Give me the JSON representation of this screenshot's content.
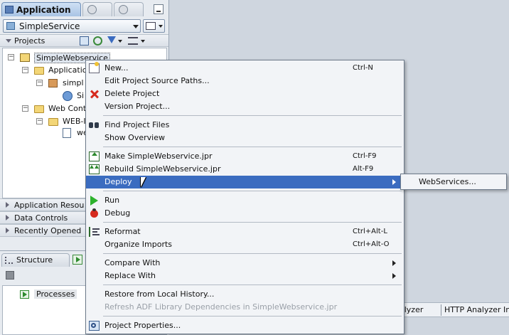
{
  "left_panel": {
    "tabs": [
      {
        "label": "Application"
      }
    ],
    "app_dropdown": "SimpleService",
    "projects_label": "Projects",
    "tree": [
      {
        "label": "SimpleWebservice"
      },
      {
        "label": "Applicatio"
      },
      {
        "label": "simpl"
      },
      {
        "label": "Si"
      },
      {
        "label": "Web Cont"
      },
      {
        "label": "WEB-I"
      },
      {
        "label": "we"
      }
    ],
    "sections": [
      {
        "label": "Application Resou"
      },
      {
        "label": "Data Controls"
      },
      {
        "label": "Recently Opened"
      }
    ]
  },
  "structure_panel": {
    "tab_label": "Structure",
    "processes_label": "Processes"
  },
  "bottom_tabs": [
    {
      "label": "alyzer"
    },
    {
      "label": "HTTP Analyzer In"
    }
  ],
  "context_menu": {
    "items": [
      {
        "label": "New...",
        "shortcut": "Ctrl-N"
      },
      {
        "label": "Edit Project Source Paths...",
        "shortcut": ""
      },
      {
        "label": "Delete Project",
        "shortcut": ""
      },
      {
        "label": "Version Project...",
        "shortcut": ""
      },
      {
        "label": "Find Project Files",
        "shortcut": ""
      },
      {
        "label": "Show Overview",
        "shortcut": ""
      },
      {
        "label": "Make SimpleWebservice.jpr",
        "shortcut": "Ctrl-F9"
      },
      {
        "label": "Rebuild SimpleWebservice.jpr",
        "shortcut": "Alt-F9"
      },
      {
        "label": "Deploy",
        "shortcut": ""
      },
      {
        "label": "Run",
        "shortcut": ""
      },
      {
        "label": "Debug",
        "shortcut": ""
      },
      {
        "label": "Reformat",
        "shortcut": "Ctrl+Alt-L"
      },
      {
        "label": "Organize Imports",
        "shortcut": "Ctrl+Alt-O"
      },
      {
        "label": "Compare With",
        "shortcut": ""
      },
      {
        "label": "Replace With",
        "shortcut": ""
      },
      {
        "label": "Restore from Local History...",
        "shortcut": ""
      },
      {
        "label": "Refresh ADF Library Dependencies in SimpleWebservice.jpr",
        "shortcut": ""
      },
      {
        "label": "Project Properties...",
        "shortcut": ""
      }
    ]
  },
  "submenu": {
    "items": [
      {
        "label": "WebServices..."
      }
    ]
  },
  "colors": {
    "highlight": "#3b6cc0",
    "background": "#cfd6df",
    "menu": "#f2f4f7"
  }
}
